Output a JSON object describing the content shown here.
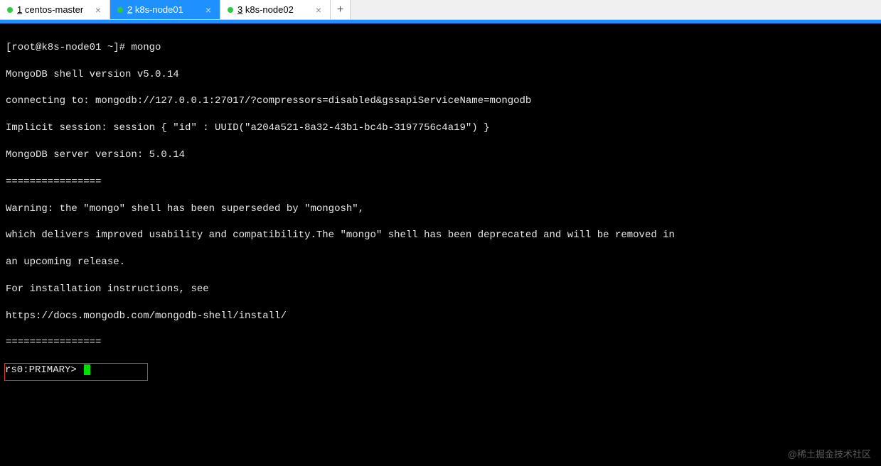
{
  "tabs": [
    {
      "num": "1",
      "label": "centos-master",
      "active": false
    },
    {
      "num": "2",
      "label": "k8s-node01",
      "active": true
    },
    {
      "num": "3",
      "label": "k8s-node02",
      "active": false
    }
  ],
  "add_icon": "+",
  "close_icon": "×",
  "terminal": {
    "lines": [
      "[root@k8s-node01 ~]# mongo",
      "MongoDB shell version v5.0.14",
      "connecting to: mongodb://127.0.0.1:27017/?compressors=disabled&gssapiServiceName=mongodb",
      "Implicit session: session { \"id\" : UUID(\"a204a521-8a32-43b1-bc4b-3197756c4a19\") }",
      "MongoDB server version: 5.0.14",
      "================",
      "Warning: the \"mongo\" shell has been superseded by \"mongosh\",",
      "which delivers improved usability and compatibility.The \"mongo\" shell has been deprecated and will be removed in",
      "an upcoming release.",
      "For installation instructions, see",
      "https://docs.mongodb.com/mongodb-shell/install/",
      "================"
    ],
    "prompt": "rs0:PRIMARY> "
  },
  "watermark": "@稀土掘金技术社区"
}
